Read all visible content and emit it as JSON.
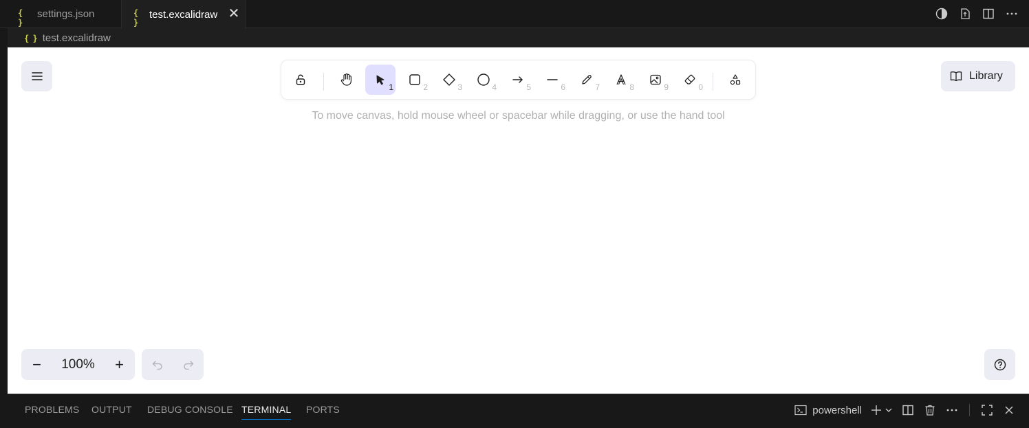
{
  "tabs": [
    {
      "label": "settings.json",
      "icon": "json-braces-icon"
    },
    {
      "label": "test.excalidraw",
      "icon": "json-braces-icon",
      "active": true
    }
  ],
  "json_icon_glyph": "{ }",
  "close_glyph": "✕",
  "breadcrumb": {
    "label": "test.excalidraw"
  },
  "toolbar": {
    "tools": [
      {
        "name": "lock",
        "key": ""
      },
      {
        "name": "hand",
        "key": ""
      },
      {
        "name": "selection",
        "key": "1",
        "active": true
      },
      {
        "name": "rectangle",
        "key": "2"
      },
      {
        "name": "diamond",
        "key": "3"
      },
      {
        "name": "ellipse",
        "key": "4"
      },
      {
        "name": "arrow",
        "key": "5"
      },
      {
        "name": "line",
        "key": "6"
      },
      {
        "name": "draw",
        "key": "7"
      },
      {
        "name": "text",
        "key": "8"
      },
      {
        "name": "image",
        "key": "9"
      },
      {
        "name": "eraser",
        "key": "0"
      },
      {
        "name": "more-tools",
        "key": ""
      }
    ]
  },
  "hint": "To move canvas, hold mouse wheel or spacebar while dragging, or use the hand tool",
  "library": {
    "label": "Library"
  },
  "zoom": {
    "minus": "−",
    "value": "100%",
    "plus": "+"
  },
  "panel": {
    "tabs": [
      "PROBLEMS",
      "OUTPUT",
      "DEBUG CONSOLE",
      "TERMINAL",
      "PORTS"
    ],
    "active_tab": "TERMINAL",
    "terminal_name": "powershell"
  },
  "colors": {
    "selection_active_bg": "#e0dfff",
    "island_bg": "#ececf4",
    "json_icon": "#cbcb41",
    "panel_accent": "#0078d4"
  }
}
